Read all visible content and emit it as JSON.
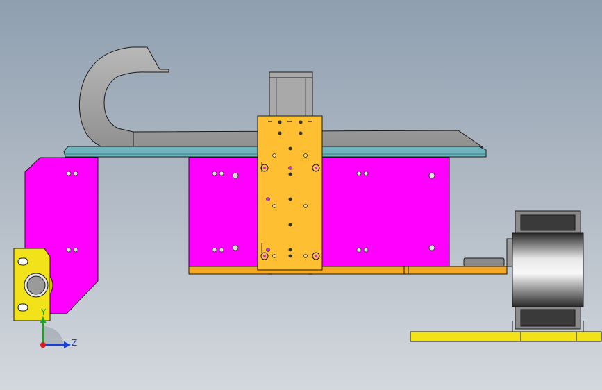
{
  "viewport": {
    "background_top": "#8f9fb0",
    "background_bottom": "#d3d8dd"
  },
  "colors": {
    "magenta_plate": "#ff00ff",
    "orange_carriage": "#ffbf33",
    "orange_rail": "#f5a623",
    "yellow_bracket": "#f2e21a",
    "teal_rail": "#6fb4bc",
    "gray_chain": "#a8a8a8",
    "motor_steel": "#7a7a7a",
    "edge": "#1a1a1a"
  },
  "triad": {
    "y_label": "Y",
    "z_label": "Z",
    "y_color": "#1aa51a",
    "z_color": "#1a3fd6",
    "origin_color": "#d81a1a"
  },
  "icons": {
    "triad": "coordinate-triad-icon"
  }
}
